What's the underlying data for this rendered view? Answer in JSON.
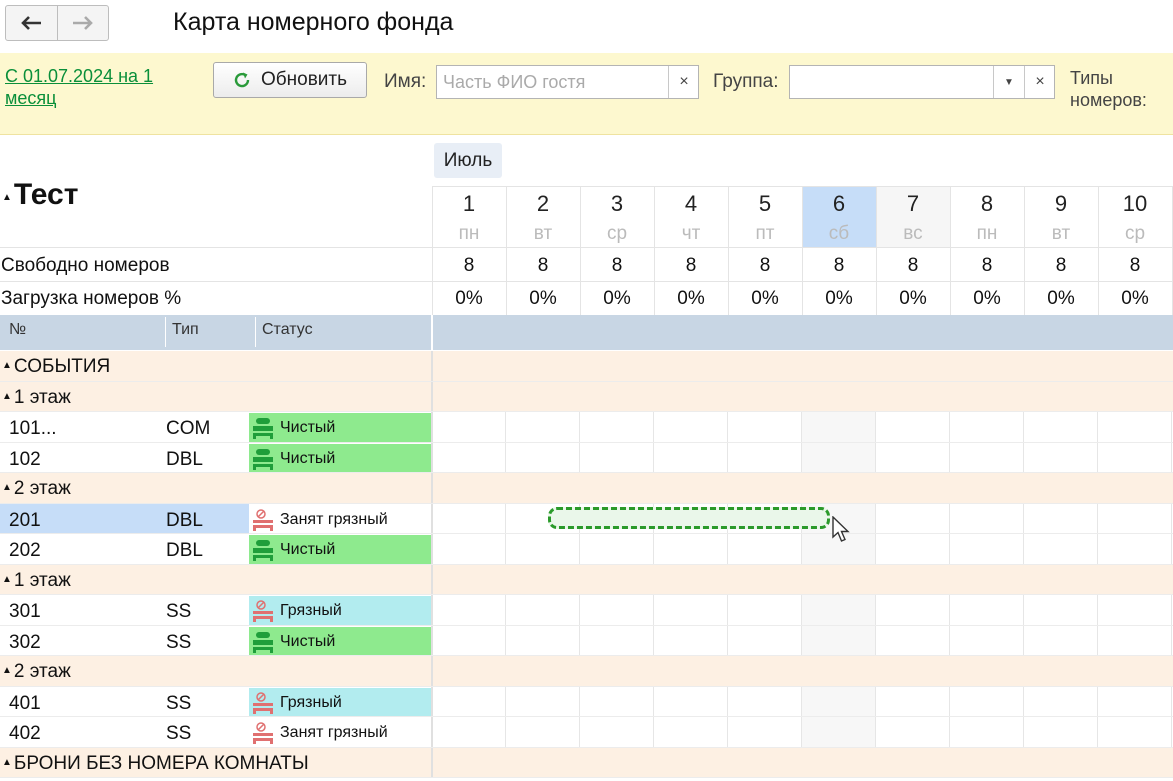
{
  "window": {
    "title": "Карта номерного фонда"
  },
  "filters": {
    "period_link": "С 01.07.2024 на 1 месяц",
    "refresh_label": "Обновить",
    "name_label": "Имя:",
    "name_placeholder": "Часть ФИО гостя",
    "name_value": "",
    "group_label": "Группа:",
    "group_value": "",
    "room_types_label": "Типы номеров:"
  },
  "board": {
    "title": "Тест",
    "month": "Июль",
    "free_rooms_label": "Свободно номеров",
    "load_label": "Загрузка номеров %",
    "columns": {
      "number": "№",
      "type": "Тип",
      "status": "Статус"
    },
    "days": [
      {
        "num": "1",
        "wd": "пн",
        "free": "8",
        "load": "0%"
      },
      {
        "num": "2",
        "wd": "вт",
        "free": "8",
        "load": "0%"
      },
      {
        "num": "3",
        "wd": "ср",
        "free": "8",
        "load": "0%"
      },
      {
        "num": "4",
        "wd": "чт",
        "free": "8",
        "load": "0%"
      },
      {
        "num": "5",
        "wd": "пт",
        "free": "8",
        "load": "0%"
      },
      {
        "num": "6",
        "wd": "сб",
        "free": "8",
        "load": "0%"
      },
      {
        "num": "7",
        "wd": "вс",
        "free": "8",
        "load": "0%"
      },
      {
        "num": "8",
        "wd": "пн",
        "free": "8",
        "load": "0%"
      },
      {
        "num": "9",
        "wd": "вт",
        "free": "8",
        "load": "0%"
      },
      {
        "num": "10",
        "wd": "ср",
        "free": "8",
        "load": "0%"
      }
    ],
    "rows": [
      {
        "kind": "group",
        "label": "СОБЫТИЯ"
      },
      {
        "kind": "group",
        "label": "1 этаж"
      },
      {
        "kind": "room",
        "number": "101...",
        "type": "COM",
        "status": "Чистый",
        "state": "clean"
      },
      {
        "kind": "room",
        "number": "102",
        "type": "DBL",
        "status": "Чистый",
        "state": "clean"
      },
      {
        "kind": "group",
        "label": "2 этаж"
      },
      {
        "kind": "room",
        "number": "201",
        "type": "DBL",
        "status": "Занят грязный",
        "state": "occupied-dirty",
        "selected": true
      },
      {
        "kind": "room",
        "number": "202",
        "type": "DBL",
        "status": "Чистый",
        "state": "clean"
      },
      {
        "kind": "group",
        "label": "1 этаж"
      },
      {
        "kind": "room",
        "number": "301",
        "type": "SS",
        "status": "Грязный",
        "state": "dirty"
      },
      {
        "kind": "room",
        "number": "302",
        "type": "SS",
        "status": "Чистый",
        "state": "clean"
      },
      {
        "kind": "group",
        "label": "2 этаж"
      },
      {
        "kind": "room",
        "number": "401",
        "type": "SS",
        "status": "Грязный",
        "state": "dirty"
      },
      {
        "kind": "room",
        "number": "402",
        "type": "SS",
        "status": "Занят грязный",
        "state": "occupied-dirty"
      },
      {
        "kind": "group",
        "label": "БРОНИ БЕЗ НОМЕРА КОМНАТЫ"
      }
    ]
  },
  "colors": {
    "clean": "#8eea8e",
    "dirty": "#b2ecef",
    "occupied-dirty": "#fdf0e3",
    "group": "#fdf0e3",
    "selected": "#c6ddf8",
    "today": "#c6ddf8",
    "col_header": "#c8d6e4",
    "link": "#0a8f3a",
    "drag_border": "#2a9a2a"
  },
  "icons": {
    "back": "arrow-left-icon",
    "forward": "arrow-right-icon",
    "refresh": "refresh-icon",
    "clean": "bed-green-icon",
    "dirty": "bed-red-icon",
    "cursor": "mouse-pointer-icon"
  }
}
